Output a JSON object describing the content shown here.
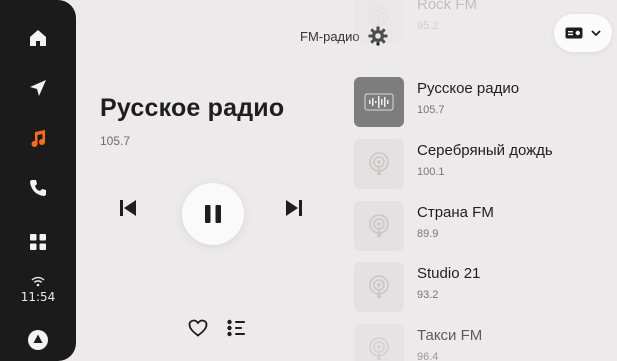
{
  "sidebar": {
    "items": [
      {
        "name": "home",
        "icon": "home-icon"
      },
      {
        "name": "navigation",
        "icon": "navigation-arrow-icon"
      },
      {
        "name": "music",
        "icon": "music-note-icon",
        "active_color": "#ff6a1a"
      },
      {
        "name": "phone",
        "icon": "phone-icon"
      },
      {
        "name": "apps",
        "icon": "apps-grid-icon"
      },
      {
        "name": "alice",
        "icon": "alice-assistant-icon"
      }
    ],
    "clock": "11:54"
  },
  "header": {
    "source_label": "FM-радио"
  },
  "now_playing": {
    "title": "Русское радио",
    "frequency": "105.7"
  },
  "stations": [
    {
      "name": "Rock FM",
      "frequency": "95.2"
    },
    {
      "name": "Русское радио",
      "frequency": "105.7"
    },
    {
      "name": "Серебряный дождь",
      "frequency": "100.1"
    },
    {
      "name": "Страна FM",
      "frequency": "89.9"
    },
    {
      "name": "Studio 21",
      "frequency": "93.2"
    },
    {
      "name": "Такси FM",
      "frequency": "96.4"
    }
  ],
  "colors": {
    "accent": "#ff6a1a",
    "sidebar_bg": "#1b1b1b",
    "main_bg": "#eceaea"
  }
}
